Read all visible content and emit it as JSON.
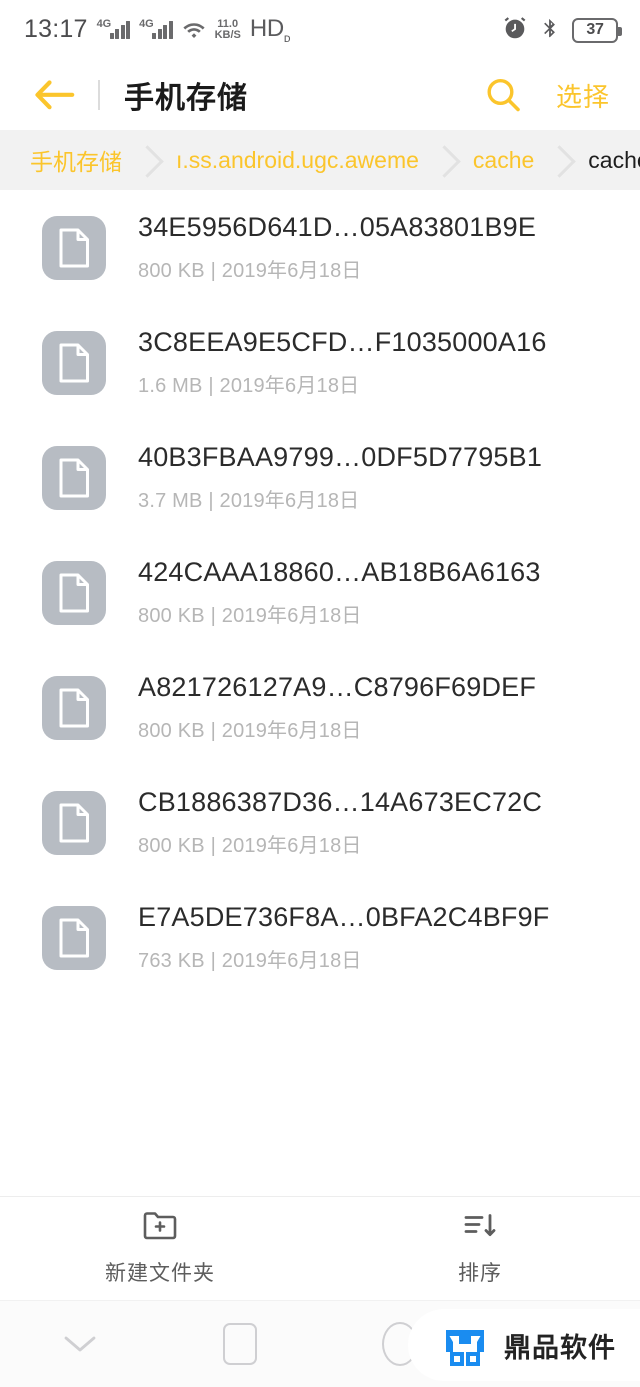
{
  "statusbar": {
    "time": "13:17",
    "signal1_label": "4G",
    "signal2_label": "4G",
    "wifi_icon": "wifi-icon",
    "netspeed_value": "11.0",
    "netspeed_unit": "KB/S",
    "hd_label": "HD",
    "hd_sub": "ᴅ",
    "alarm_icon": "alarm-clock-icon",
    "bluetooth_icon": "bluetooth-icon",
    "battery_level": "37"
  },
  "appbar": {
    "back_icon": "back-arrow-icon",
    "title": "手机存储",
    "search_icon": "search-icon",
    "select_label": "选择"
  },
  "breadcrumb": {
    "items": [
      {
        "label": "手机存储",
        "current": false
      },
      {
        "label": "ı.ss.android.ugc.aweme",
        "current": false
      },
      {
        "label": "cache",
        "current": false
      },
      {
        "label": "cache",
        "current": true
      }
    ]
  },
  "files": [
    {
      "name": "34E5956D641D…05A83801B9E",
      "size": "800 KB",
      "separator": "|",
      "date": "2019年6月18日",
      "icon": "file-document-icon"
    },
    {
      "name": "3C8EEA9E5CFD…F1035000A16",
      "size": "1.6 MB",
      "separator": "|",
      "date": "2019年6月18日",
      "icon": "file-document-icon"
    },
    {
      "name": "40B3FBAA9799…0DF5D7795B1",
      "size": "3.7 MB",
      "separator": "|",
      "date": "2019年6月18日",
      "icon": "file-document-icon"
    },
    {
      "name": "424CAAA18860…AB18B6A6163",
      "size": "800 KB",
      "separator": "|",
      "date": "2019年6月18日",
      "icon": "file-document-icon"
    },
    {
      "name": "A821726127A9…C8796F69DEF",
      "size": "800 KB",
      "separator": "|",
      "date": "2019年6月18日",
      "icon": "file-document-icon"
    },
    {
      "name": "CB1886387D36…14A673EC72C",
      "size": "800 KB",
      "separator": "|",
      "date": "2019年6月18日",
      "icon": "file-document-icon"
    },
    {
      "name": "E7A5DE736F8A…0BFA2C4BF9F",
      "size": "763 KB",
      "separator": "|",
      "date": "2019年6月18日",
      "icon": "file-document-icon"
    }
  ],
  "toolbar": {
    "new_folder_label": "新建文件夹",
    "new_folder_icon": "folder-plus-icon",
    "sort_label": "排序",
    "sort_icon": "sort-descending-icon"
  },
  "navbar": {
    "back_icon": "chevron-down-icon",
    "recents_icon": "square-icon",
    "home_icon": "circle-icon",
    "watermark_text": "鼎品软件",
    "watermark_logo": "dingpin-logo-icon"
  },
  "colors": {
    "accent": "#fbc52c",
    "breadcrumb_bg": "#f2f2f2",
    "file_icon_bg": "#b7bcc3",
    "watermark_blue": "#1a8cf0",
    "text_primary": "#2b2b2b",
    "text_secondary": "#b6b6b6"
  }
}
